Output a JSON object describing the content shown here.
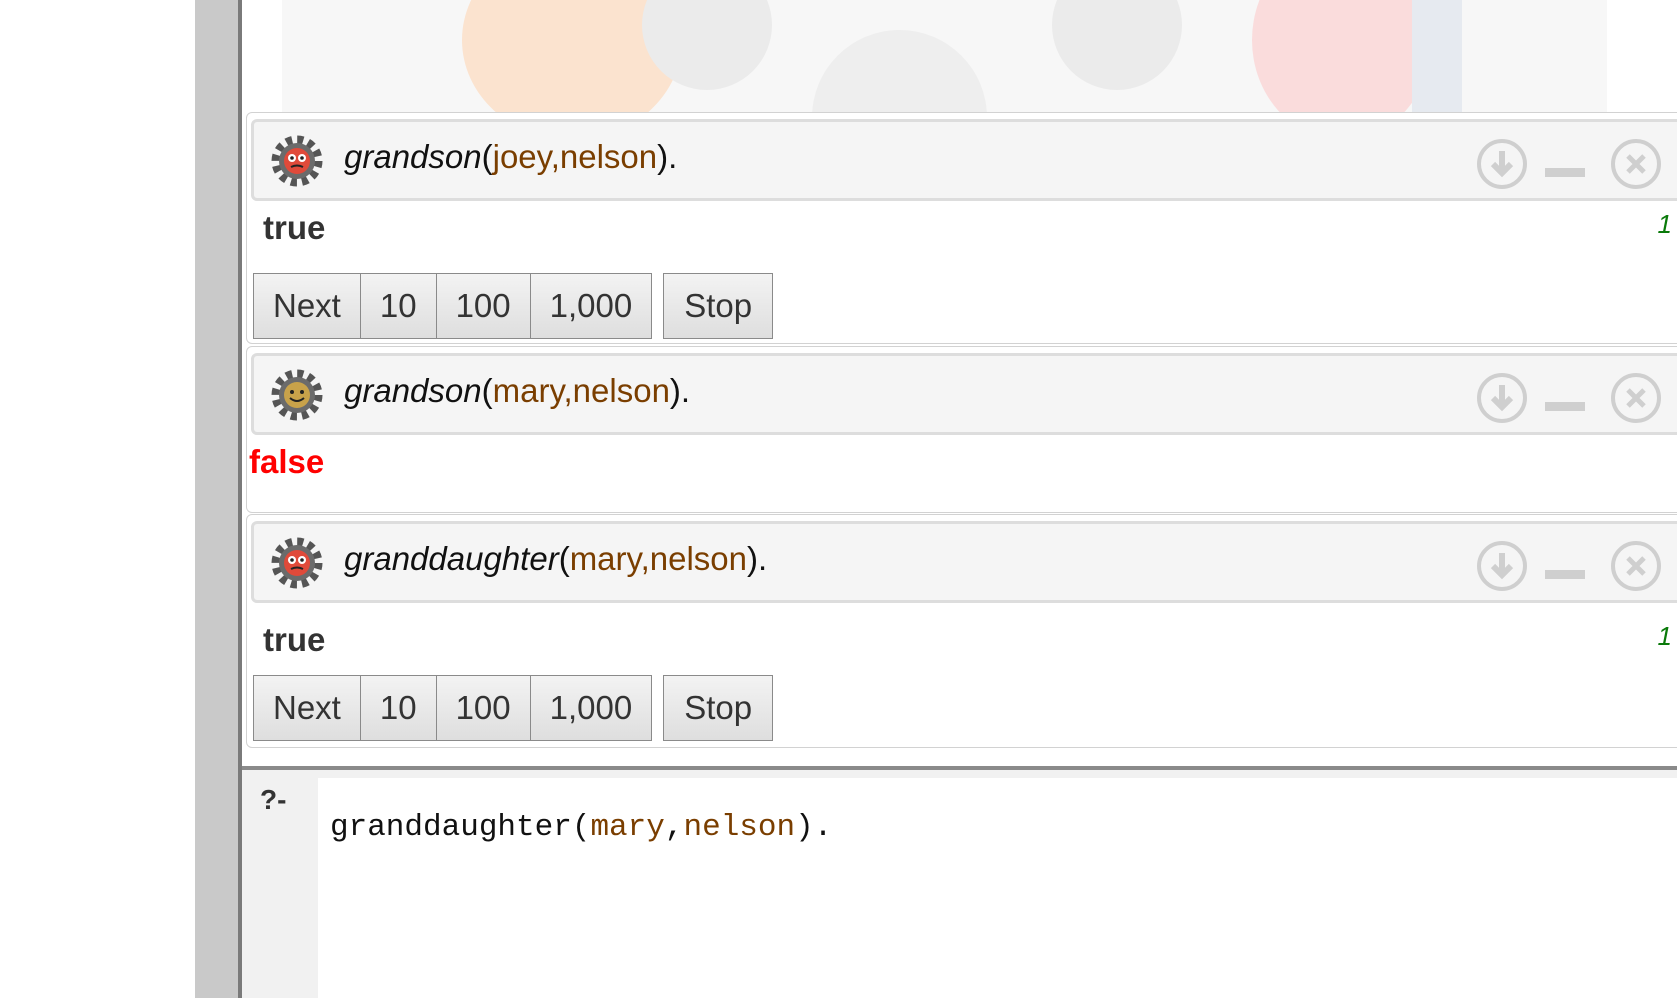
{
  "answers": [
    {
      "query": {
        "functor": "grandson",
        "open": "(",
        "arg1": "joey",
        "comma": ",",
        "arg2": "nelson",
        "close": ")."
      },
      "icon": "running-gear-icon",
      "result": "true",
      "timing": "1",
      "buttons": {
        "next": "Next",
        "b10": "10",
        "b100": "100",
        "b1000": "1,000",
        "stop": "Stop"
      }
    },
    {
      "query": {
        "functor": "grandson",
        "open": "(",
        "arg1": "mary",
        "comma": ",",
        "arg2": "nelson",
        "close": ")."
      },
      "icon": "idle-gear-icon",
      "result": "false"
    },
    {
      "query": {
        "functor": "granddaughter",
        "open": "(",
        "arg1": "mary",
        "comma": ",",
        "arg2": "nelson",
        "close": ")."
      },
      "icon": "running-gear-icon",
      "result": "true",
      "timing": "1",
      "buttons": {
        "next": "Next",
        "b10": "10",
        "b100": "100",
        "b1000": "1,000",
        "stop": "Stop"
      }
    }
  ],
  "prompt": "?-",
  "editor": {
    "functor": "granddaughter",
    "open": "(",
    "arg1": "mary",
    "comma": ",",
    "arg2": "nelson",
    "close": ")."
  },
  "colors": {
    "argument": "#7a3e00",
    "false": "#ff0000",
    "timing": "#0a7a0a"
  }
}
